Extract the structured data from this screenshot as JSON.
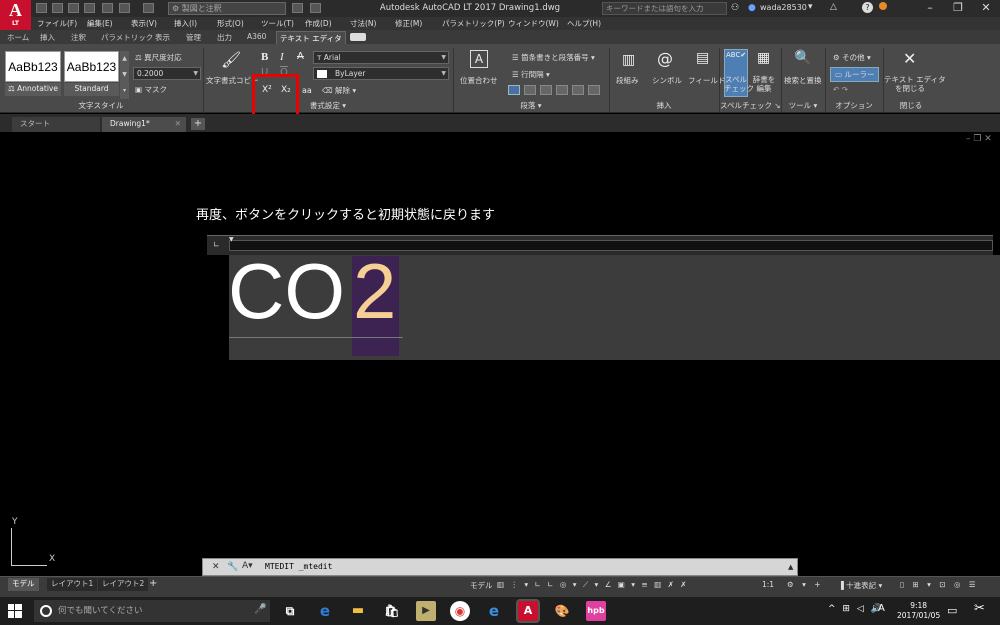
{
  "title_bar": {
    "app_logo": "A",
    "app_logo_sub": "LT",
    "workspace_field": "製図と注釈",
    "title": "Autodesk AutoCAD LT 2017    Drawing1.dwg",
    "search_placeholder": "キーワードまたは語句を入力",
    "user_name": "wada28530"
  },
  "menu": [
    "ファイル(F)",
    "編集(E)",
    "表示(V)",
    "挿入(I)",
    "形式(O)",
    "ツール(T)",
    "作成(D)",
    "寸法(N)",
    "修正(M)",
    "パラメトリック(P)",
    "ウィンドウ(W)",
    "ヘルプ(H)"
  ],
  "ribbon_tabs": [
    "ホーム",
    "挿入",
    "注釈",
    "パラメトリック",
    "表示",
    "管理",
    "出力",
    "A360",
    "テキスト エディタ"
  ],
  "ribbon": {
    "style": {
      "style_1": "AaBb123",
      "style_2": "AaBb123",
      "annotative": "Annotative",
      "standard": "Standard",
      "scale_label": "異尺度対応",
      "height_value": "0.2000",
      "mask": "マスク",
      "panel_label": "文字スタイル"
    },
    "format": {
      "match": "文字書式コピー",
      "bold": "B",
      "italic": "I",
      "strike": "A",
      "underline": "U",
      "overline": "O",
      "superscript": "X²",
      "subscript": "X₂",
      "case": "aa",
      "font": "Arial",
      "color": "ByLayer",
      "clear": "解除",
      "panel_label": "書式設定"
    },
    "paragraph": {
      "justify": "位置合わせ",
      "bullets": "箇条書きと段落番号",
      "line_spacing": "行間隔",
      "panel_label": "段落"
    },
    "insert": {
      "columns": "段組み",
      "symbol": "シンボル",
      "field": "フィールド",
      "panel_label": "挿入"
    },
    "spell": {
      "spell_check_line1": "スペル",
      "spell_check_line2": "チェック",
      "edit_dict_line1": "辞書を",
      "edit_dict_line2": "編集",
      "panel_label": "スペルチェック"
    },
    "tools": {
      "find": "検索と置換",
      "panel_label": "ツール"
    },
    "options": {
      "more": "その他",
      "ruler": "ルーラー",
      "panel_label": "オプション"
    },
    "close": {
      "close_line1": "テキスト エディタ",
      "close_line2": "を閉じる",
      "panel_label": "閉じる"
    }
  },
  "doc_tabs": [
    "スタート",
    "Drawing1*"
  ],
  "canvas": {
    "instruction": "再度、ボタンをクリックすると初期状態に戻ります",
    "text_main": "CO",
    "text_selected": "2",
    "ucs_y": "Y",
    "ucs_x": "X"
  },
  "command_line": {
    "text": "MTEDIT _mtedit"
  },
  "layout_tabs": [
    "モデル",
    "レイアウト1",
    "レイアウト2"
  ],
  "status": {
    "model": "モデル",
    "scale": "1:1",
    "units": "十進表記"
  },
  "taskbar": {
    "search_placeholder": "何でも聞いてください",
    "ime": "A",
    "time": "9:18",
    "date": "2017/01/05"
  },
  "colors": {
    "autocad_red": "#c8102e",
    "selection_purple": "#3c2352",
    "selected_text": "#f5cf94",
    "highlight_box": "#e00000"
  }
}
